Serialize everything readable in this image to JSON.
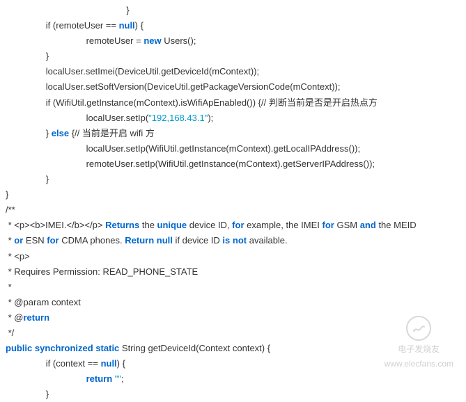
{
  "lines": [
    {
      "indent": 12,
      "segs": [
        {
          "t": "}"
        }
      ]
    },
    {
      "indent": 4,
      "segs": [
        {
          "t": "if"
        },
        {
          "t": " (remoteUser == "
        },
        {
          "t": "null",
          "c": "kw"
        },
        {
          "t": ") {"
        }
      ]
    },
    {
      "indent": 8,
      "segs": [
        {
          "t": "remoteUser = "
        },
        {
          "t": "new",
          "c": "kw"
        },
        {
          "t": " Users();"
        }
      ]
    },
    {
      "indent": 4,
      "segs": [
        {
          "t": "}"
        }
      ]
    },
    {
      "indent": 4,
      "segs": [
        {
          "t": "localUser.setImei(DeviceUtil.getDeviceId(mContext));"
        }
      ]
    },
    {
      "indent": 4,
      "segs": [
        {
          "t": "localUser.setSoftVersion(DeviceUtil.getPackageVersionCode(mContext));"
        }
      ]
    },
    {
      "indent": 4,
      "segs": [
        {
          "t": "if"
        },
        {
          "t": " (WifiUtil.getInstance(mContext).isWifiApEnabled()) {// 判断当前是否是开启热点方"
        }
      ]
    },
    {
      "indent": 8,
      "segs": [
        {
          "t": "localUser.setIp("
        },
        {
          "t": "\"192,168.43.1\"",
          "c": "str"
        },
        {
          "t": ");"
        }
      ]
    },
    {
      "indent": 4,
      "segs": [
        {
          "t": "} "
        },
        {
          "t": "else",
          "c": "kw"
        },
        {
          "t": " {// 当前是开启 wifi 方"
        }
      ]
    },
    {
      "indent": 8,
      "segs": [
        {
          "t": "localUser.setIp(WifiUtil.getInstance(mContext).getLocalIPAddress());"
        }
      ]
    },
    {
      "indent": 8,
      "segs": [
        {
          "t": "remoteUser.setIp(WifiUtil.getInstance(mContext).getServerIPAddress());"
        }
      ]
    },
    {
      "indent": 4,
      "segs": [
        {
          "t": "}"
        }
      ]
    },
    {
      "indent": 0,
      "segs": [
        {
          "t": "}"
        }
      ]
    },
    {
      "indent": 0,
      "segs": [
        {
          "t": "/**"
        }
      ]
    },
    {
      "indent": 0,
      "segs": [
        {
          "t": " * <p><b>IMEI.</b></p> "
        },
        {
          "t": "Returns",
          "c": "kw"
        },
        {
          "t": " the "
        },
        {
          "t": "unique",
          "c": "kw"
        },
        {
          "t": " device ID, "
        },
        {
          "t": "for",
          "c": "kw"
        },
        {
          "t": " example, the IMEI "
        },
        {
          "t": "for",
          "c": "kw"
        },
        {
          "t": " GSM "
        },
        {
          "t": "and",
          "c": "kw"
        },
        {
          "t": " the MEID"
        }
      ]
    },
    {
      "indent": 0,
      "segs": [
        {
          "t": " * "
        },
        {
          "t": "or",
          "c": "kw"
        },
        {
          "t": " ESN "
        },
        {
          "t": "for",
          "c": "kw"
        },
        {
          "t": " CDMA phones. "
        },
        {
          "t": "Return",
          "c": "kw"
        },
        {
          "t": " "
        },
        {
          "t": "null",
          "c": "kw"
        },
        {
          "t": " if device ID "
        },
        {
          "t": "is",
          "c": "kw"
        },
        {
          "t": " "
        },
        {
          "t": "not",
          "c": "kw"
        },
        {
          "t": " available."
        }
      ]
    },
    {
      "indent": 0,
      "segs": [
        {
          "t": " * <p>"
        }
      ]
    },
    {
      "indent": 0,
      "segs": [
        {
          "t": " * Requires Permission: READ_PHONE_STATE"
        }
      ]
    },
    {
      "indent": 0,
      "segs": [
        {
          "t": " *"
        }
      ]
    },
    {
      "indent": 0,
      "segs": [
        {
          "t": " * @param context"
        }
      ]
    },
    {
      "indent": 0,
      "segs": [
        {
          "t": " * @"
        },
        {
          "t": "return",
          "c": "kw"
        }
      ]
    },
    {
      "indent": 0,
      "segs": [
        {
          "t": " */"
        }
      ]
    },
    {
      "indent": 0,
      "segs": [
        {
          "t": "public",
          "c": "kw"
        },
        {
          "t": " "
        },
        {
          "t": "synchronized",
          "c": "kw"
        },
        {
          "t": " "
        },
        {
          "t": "static",
          "c": "kw"
        },
        {
          "t": " String getDeviceId(Context context) {"
        }
      ]
    },
    {
      "indent": 4,
      "segs": [
        {
          "t": "if"
        },
        {
          "t": " (context == "
        },
        {
          "t": "null",
          "c": "kw"
        },
        {
          "t": ") {"
        }
      ]
    },
    {
      "indent": 8,
      "segs": [
        {
          "t": "return",
          "c": "kw"
        },
        {
          "t": " "
        },
        {
          "t": "\"\"",
          "c": "str"
        },
        {
          "t": ";"
        }
      ]
    },
    {
      "indent": 4,
      "segs": [
        {
          "t": "}"
        }
      ]
    }
  ],
  "watermark": {
    "site": "电子发烧友",
    "url": "www.elecfans.com"
  }
}
